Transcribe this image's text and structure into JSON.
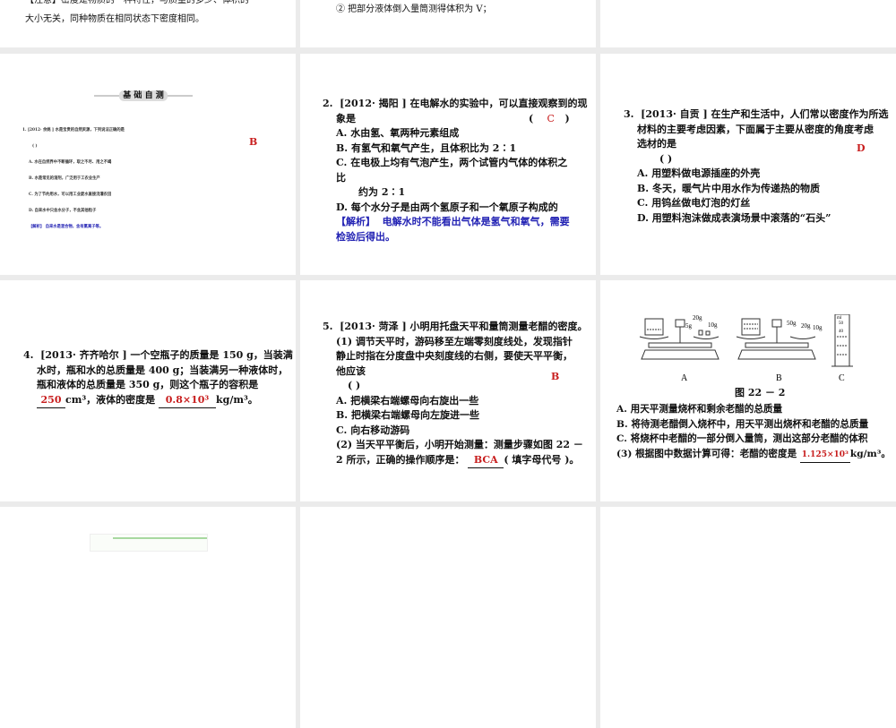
{
  "slides": [
    {
      "lines": [
        "【注意】密度是物质的一种特性，与质量的多少、体积的",
        "大小无关，同种物质在相同状态下密度相同。"
      ]
    },
    {
      "lines": [
        "② 把部分液体倒入量筒测得体积为 V；"
      ]
    },
    {},
    {
      "banner": "基 础 自 测",
      "question": "1.  [2012· 余姚 ] 水是宝贵的自然资源，下列说法正确的是",
      "bracket": "(        )",
      "answer": "B",
      "options": [
        "A. 水在自然界中不断循环，取之不尽、用之不竭",
        "B. 水是常见的溶剂，广泛用于工农业生产",
        "C. 为了节约用水，可以用工业废水直接浇灌农田",
        "D. 自来水中只含水分子，不含其他粒子"
      ],
      "analysis_label": "【解析】",
      "analysis": "自来水是混合物，含有氯离子等。"
    },
    {
      "num": "2.",
      "lines": [
        "[2012· 揭阳 ] 在电解水的实验中，可以直接观察到的现",
        "象是"
      ],
      "bracket_open": "(",
      "answer": "C",
      "bracket_close": ")",
      "options": [
        "A. 水由氢、氧两种元素组成",
        "B. 有氢气和氧气产生，且体积比为 2∶1",
        "C. 在电极上均有气泡产生，两个试管内气体的体积之",
        "比",
        "约为 2∶1",
        "D. 每个水分子是由两个氢原子和一个氧原子构成的"
      ],
      "analysis_label": "【解析】",
      "analysis": "电解水时不能看出气体是氢气和氧气，需要",
      "analysis2": "检验后得出。"
    },
    {
      "num": "3.",
      "lines": [
        "[2013· 自贡 ] 在生产和生活中，人们常以密度作为所选",
        "材料的主要考虑因素，下面属于主要从密度的角度考虑",
        "选材的是"
      ],
      "answer": "D",
      "bracket": "(          )",
      "options": [
        "A. 用塑料做电源插座的外壳",
        "B. 冬天，暖气片中用水作为传递热的物质",
        "C. 用钨丝做电灯泡的灯丝",
        "D. 用塑料泡沫做成表演场景中滚落的“石头”"
      ]
    },
    {
      "num": "4.",
      "lines": [
        "[2013· 齐齐哈尔 ] 一个空瓶子的质量是 150 g，当装满",
        "水时，瓶和水的总质量是 400 g；当装满另一种液体时，",
        "瓶和液体的总质量是 350 g，则这个瓶子的容积是"
      ],
      "answer1": "250",
      "unit1": "cm³，液体的密度是",
      "answer2": "0.8×10³",
      "unit2": "kg/m³。"
    },
    {
      "num": "5.",
      "lines": [
        "[2013· 菏泽 ] 小明用托盘天平和量筒测量老醋的密度。",
        "(1) 调节天平时，游码移至左端零刻度线处，发现指针",
        "静止时指在分度盘中央刻度线的右侧，要使天平平衡，",
        "他应该"
      ],
      "answer1": "B",
      "bracket": "(          )",
      "options": [
        "A. 把横梁右端螺母向右旋出一些",
        "B. 把横梁右端螺母向左旋进一些",
        "C. 向右移动游码"
      ],
      "part2a": "(2) 当天平平衡后，小明开始测量：测量步骤如图 22 －",
      "part2b": "2 所示，正确的操作顺序是：",
      "answer2": "BCA",
      "part2c": "( 填字母代号 )。"
    },
    {
      "figure": {
        "weights_a": [
          "5g",
          "20g",
          "10g"
        ],
        "weights_b": [
          "50g",
          "20g",
          "10g"
        ],
        "cyl_unit": "ml",
        "cyl_marks": [
          "50",
          "40"
        ],
        "labels": [
          "A",
          "B",
          "C"
        ],
        "caption": "图 22 － 2"
      },
      "options": [
        "A. 用天平测量烧杯和剩余老醋的总质量",
        "B. 将待测老醋倒入烧杯中，用天平测出烧杯和老醋的总质量",
        "C. 将烧杯中老醋的一部分倒入量筒，测出这部分老醋的体积"
      ],
      "part3": "(3) 根据图中数据计算可得：老醋的密度是",
      "answer": "1.125×10³",
      "unit": "kg/m³。"
    }
  ]
}
